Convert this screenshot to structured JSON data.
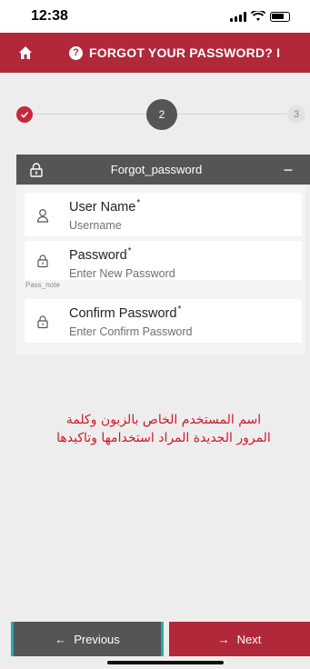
{
  "status_bar": {
    "time": "12:38"
  },
  "header": {
    "title": "FORGOT YOUR PASSWORD? I"
  },
  "stepper": {
    "step1": "",
    "step2": "2",
    "step3": "3"
  },
  "section": {
    "title": "Forgot_password",
    "collapse": "−"
  },
  "form": {
    "username": {
      "label": "User Name",
      "required": "*",
      "placeholder": "Username"
    },
    "password": {
      "label": "Password",
      "required": "*",
      "placeholder": "Enter New Password"
    },
    "pass_note": "Pass_note",
    "confirm": {
      "label": "Confirm Password",
      "required": "*",
      "placeholder": "Enter Confirm Password"
    }
  },
  "note_ar": "اسم المستخدم الخاص بالزبون وكلمة المرور الجديدة المراد استخدامها وتاكيدها",
  "footer": {
    "prev_arrow": "←",
    "prev_label": "Previous",
    "next_arrow": "→",
    "next_label": "Next"
  },
  "colors": {
    "brand_red": "#b0283a",
    "dark_gray": "#555555",
    "accent_teal": "#2aa6b8",
    "note_red": "#d1182b"
  }
}
